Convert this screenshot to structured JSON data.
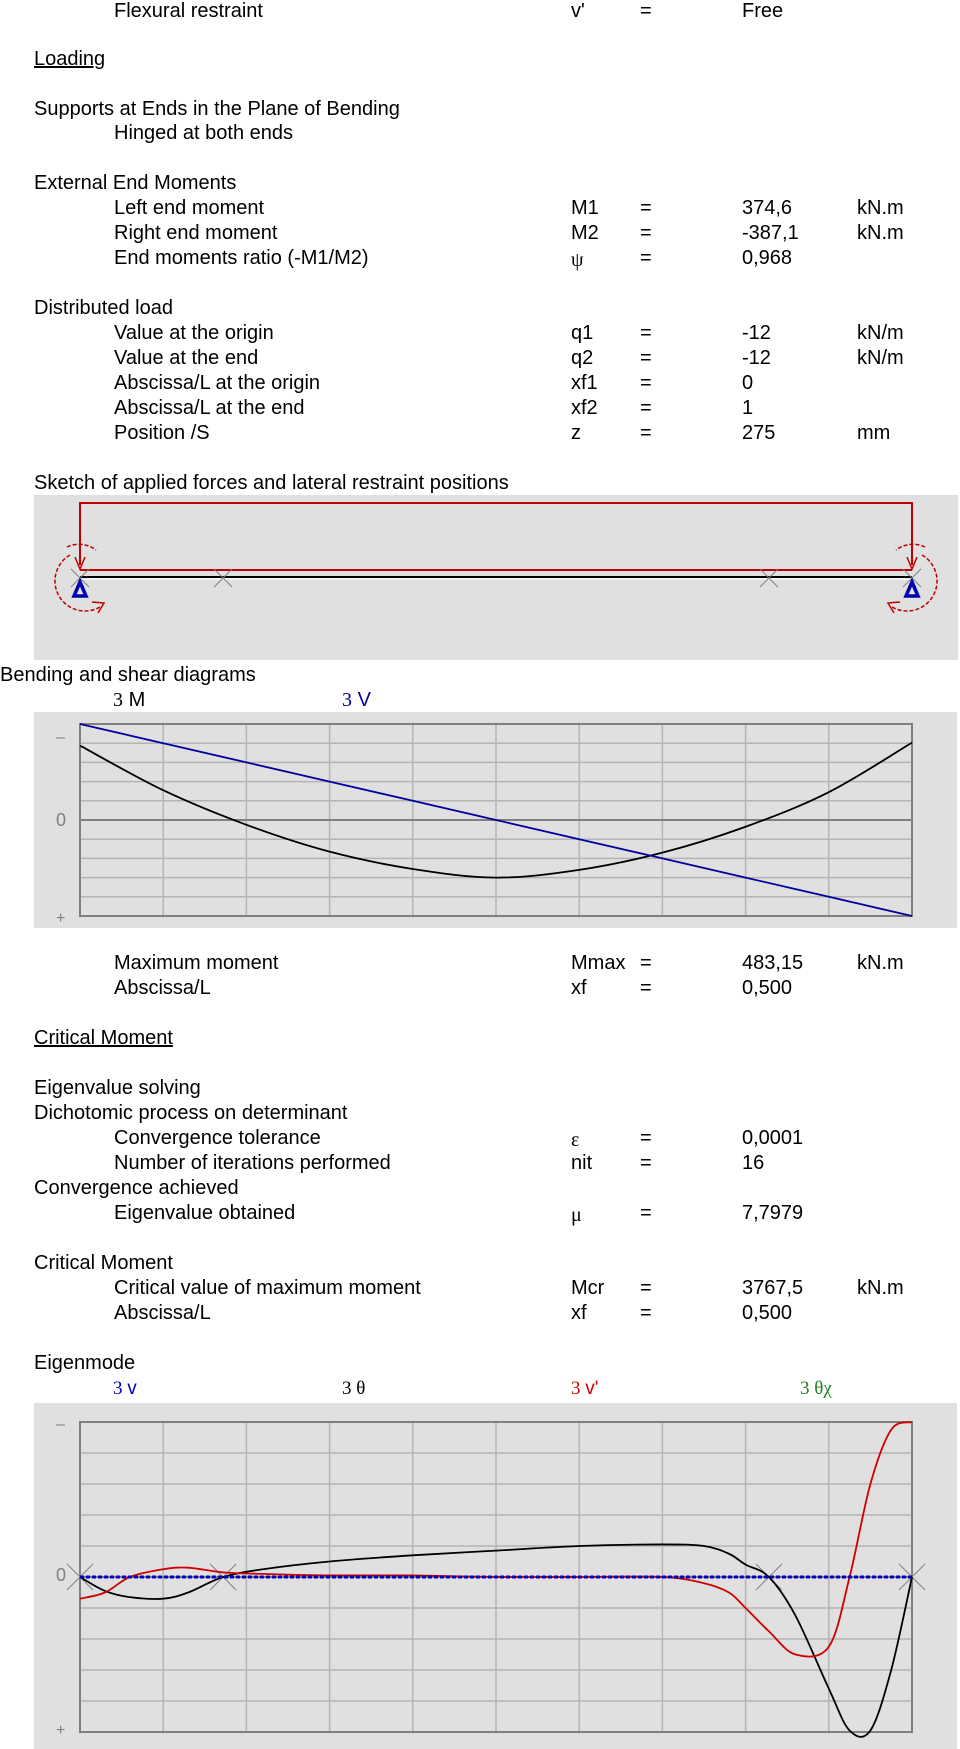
{
  "rows": [
    {
      "id": "flex",
      "label": "Flexural restraint",
      "symbol": "v'",
      "eq": "=",
      "value": "Free",
      "unit": ""
    },
    {
      "id": "left_moment",
      "label": "Left end moment",
      "symbol": "M1",
      "eq": "=",
      "value": "374,6",
      "unit": "kN.m"
    },
    {
      "id": "right_moment",
      "label": "Right end moment",
      "symbol": "M2",
      "eq": "=",
      "value": "-387,1",
      "unit": "kN.m"
    },
    {
      "id": "ratio",
      "label": "End moments ratio (-M1/M2)",
      "symbol": "ψ",
      "eq": "=",
      "value": "0,968",
      "unit": ""
    },
    {
      "id": "q1",
      "label": "Value at the origin",
      "symbol": "q1",
      "eq": "=",
      "value": "-12",
      "unit": "kN/m"
    },
    {
      "id": "q2",
      "label": "Value at the end",
      "symbol": "q2",
      "eq": "=",
      "value": "-12",
      "unit": "kN/m"
    },
    {
      "id": "xf1",
      "label": "Abscissa/L at the origin",
      "symbol": "xf1",
      "eq": "=",
      "value": "0",
      "unit": ""
    },
    {
      "id": "xf2",
      "label": "Abscissa/L at the end",
      "symbol": "xf2",
      "eq": "=",
      "value": "1",
      "unit": ""
    },
    {
      "id": "z",
      "label": "Position /S",
      "symbol": "z",
      "eq": "=",
      "value": "275",
      "unit": "mm"
    },
    {
      "id": "mmax",
      "label": "Maximum moment",
      "symbol": "Mmax",
      "eq": "=",
      "value": "483,15",
      "unit": "kN.m"
    },
    {
      "id": "xf_mmax",
      "label": "Abscissa/L",
      "symbol": "xf",
      "eq": "=",
      "value": "0,500",
      "unit": ""
    },
    {
      "id": "eps",
      "label": "Convergence tolerance",
      "symbol": "ε",
      "eq": "=",
      "value": "0,0001",
      "unit": ""
    },
    {
      "id": "nit",
      "label": "Number of iterations performed",
      "symbol": "nit",
      "eq": "=",
      "value": "16",
      "unit": ""
    },
    {
      "id": "mu",
      "label": "Eigenvalue obtained",
      "symbol": "μ",
      "eq": "=",
      "value": "7,7979",
      "unit": ""
    },
    {
      "id": "mcr",
      "label": "Critical value of maximum moment",
      "symbol": "Mcr",
      "eq": "=",
      "value": "3767,5",
      "unit": "kN.m"
    },
    {
      "id": "xf_mcr",
      "label": "Abscissa/L",
      "symbol": "xf",
      "eq": "=",
      "value": "0,500",
      "unit": ""
    }
  ],
  "headings": {
    "loading": "Loading",
    "supports": "Supports at Ends in the Plane of Bending",
    "supports_value": "Hinged at both ends",
    "end_moments": "External End Moments",
    "distributed": "Distributed load",
    "sketch": "Sketch of applied forces and lateral restraint positions",
    "bending": "Bending and shear diagrams",
    "critical_moment": "Critical Moment",
    "eigen_solving": "Eigenvalue solving",
    "dichotomic": "Dichotomic process on determinant",
    "convergence": "Convergence achieved",
    "critical_moment_2": "Critical Moment",
    "eigenmode": "Eigenmode"
  },
  "colors": {
    "panel": "#e0e0e0",
    "grid": "#b4b4b4",
    "frame": "#808080",
    "moment": "#000000",
    "shear": "#0000a0",
    "load": "#c00000",
    "support": "#0000b0",
    "theta": "#000000",
    "v": "#0000c0",
    "vprime": "#d00000",
    "theta_chi": "#208020",
    "restraint": "#808080"
  },
  "sketch": {
    "restraints_x_over_L": [
      0,
      0.172,
      0.828,
      1
    ],
    "supports": [
      "hinge",
      "hinge"
    ],
    "end_moments": [
      "left",
      "right"
    ]
  },
  "chart_data": [
    {
      "type": "line",
      "title": "Bending and shear diagrams",
      "axis_labels": {
        "top": "–",
        "zero": "0",
        "bottom": "+"
      },
      "legend": [
        {
          "prefix": "3",
          "name": "M",
          "color": "#000000"
        },
        {
          "prefix": "3",
          "name": "V",
          "color": "#0000a0"
        }
      ],
      "x": [
        0,
        0.1,
        0.2,
        0.3,
        0.4,
        0.5,
        0.6,
        0.7,
        0.8,
        0.9,
        1.0
      ],
      "xlim": [
        0,
        1
      ],
      "ylim_normalized": [
        -1,
        1
      ],
      "y_inverted": true,
      "grid": {
        "cols": 10,
        "rows": 10
      },
      "series": [
        {
          "name": "M",
          "values": [
            -0.775,
            -0.31,
            0.05,
            0.33,
            0.51,
            0.6,
            0.52,
            0.34,
            0.07,
            -0.29,
            -0.806
          ]
        },
        {
          "name": "V",
          "values": [
            -1.0,
            -0.8,
            -0.6,
            -0.4,
            -0.2,
            0.0,
            0.2,
            0.4,
            0.6,
            0.8,
            1.0
          ]
        }
      ]
    },
    {
      "type": "line",
      "title": "Eigenmode",
      "axis_labels": {
        "top": "–",
        "zero": "0",
        "bottom": "+"
      },
      "legend": [
        {
          "prefix": "3",
          "name": "v",
          "color": "#0000c0"
        },
        {
          "prefix": "3",
          "name": "θ",
          "color": "#000000"
        },
        {
          "prefix": "3",
          "name": "v'",
          "color": "#d00000"
        },
        {
          "prefix": "3",
          "name": "θχ",
          "color": "#208020"
        }
      ],
      "xlim": [
        0,
        1
      ],
      "ylim_normalized": [
        -1,
        1
      ],
      "y_inverted": true,
      "grid": {
        "cols": 10,
        "rows": 10
      },
      "restraints_x": [
        0,
        0.172,
        0.828,
        1
      ],
      "x": [
        0,
        0.03,
        0.06,
        0.1,
        0.13,
        0.172,
        0.22,
        0.3,
        0.4,
        0.5,
        0.6,
        0.7,
        0.75,
        0.78,
        0.8,
        0.828,
        0.86,
        0.9,
        0.925,
        0.95,
        0.975,
        1.0
      ],
      "series": [
        {
          "name": "θ",
          "values": [
            0,
            0.09,
            0.13,
            0.14,
            0.1,
            0.0,
            -0.05,
            -0.1,
            -0.14,
            -0.17,
            -0.2,
            -0.21,
            -0.2,
            -0.15,
            -0.08,
            0.0,
            0.25,
            0.72,
            0.99,
            0.99,
            0.6,
            0.0
          ]
        },
        {
          "name": "v'",
          "values": [
            0.14,
            0.1,
            0.0,
            -0.05,
            -0.06,
            -0.03,
            -0.02,
            -0.01,
            -0.01,
            0.0,
            0.0,
            0.0,
            0.04,
            0.1,
            0.2,
            0.35,
            0.5,
            0.45,
            0.0,
            -0.6,
            -0.95,
            -1.0
          ]
        },
        {
          "name": "v",
          "values": [
            0,
            0,
            0,
            0,
            0,
            0,
            0,
            0,
            0,
            0,
            0,
            0,
            0,
            0,
            0,
            0,
            0,
            0,
            0,
            0,
            0,
            0
          ]
        }
      ]
    }
  ]
}
